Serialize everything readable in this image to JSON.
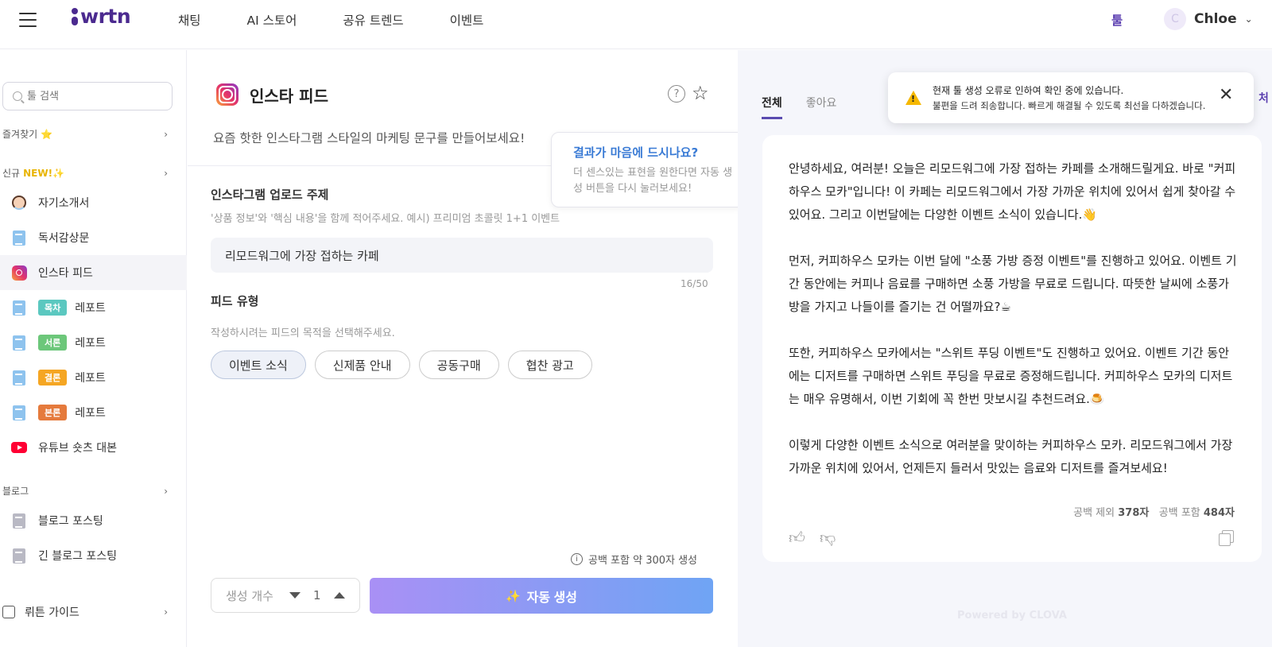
{
  "brand": "wrtn",
  "nav": {
    "links": [
      "채팅",
      "AI 스토어",
      "공유 트렌드",
      "이벤트"
    ],
    "tool_link": "툴",
    "user": {
      "avatar_initial": "C",
      "name": "Chloe"
    }
  },
  "sidebar": {
    "search_placeholder": "툴 검색",
    "favorites_label": "즐겨찾기",
    "favorites_emoji": "⭐",
    "new_label": "신규",
    "new_tag": "NEW!✨",
    "items": [
      {
        "label": "자기소개서",
        "icon": "person-icon"
      },
      {
        "label": "독서감상문",
        "icon": "document-icon"
      },
      {
        "label": "인스타 피드",
        "icon": "instagram-icon"
      },
      {
        "badge": "목차",
        "badge_color": "#5bc8c0",
        "label": "레포트",
        "icon": "document-icon"
      },
      {
        "badge": "서론",
        "badge_color": "#6cc77a",
        "label": "레포트",
        "icon": "document-icon"
      },
      {
        "badge": "결론",
        "badge_color": "#f5a623",
        "label": "레포트",
        "icon": "document-icon"
      },
      {
        "badge": "본론",
        "badge_color": "#e57a3c",
        "label": "레포트",
        "icon": "document-icon"
      },
      {
        "label": "유튜브 숏츠 대본",
        "icon": "youtube-icon"
      }
    ],
    "blog_label": "블로그",
    "blog_items": [
      {
        "label": "블로그 포스팅",
        "icon": "document-icon"
      },
      {
        "label": "긴 블로그 포스팅",
        "icon": "document-icon"
      }
    ],
    "guide_label": "뤼튼 가이드"
  },
  "main": {
    "title": "인스타 피드",
    "subtitle": "요즘 핫한 인스타그램 스타일의 마케팅 문구를 만들어보세요!",
    "topic_label": "인스타그램 업로드 주제",
    "topic_hint": "'상품 정보'와 '핵심 내용'을 함께 적어주세요. 예시) 프리미엄 초콜릿 1+1 이벤트",
    "topic_value": "리모드워그에 가장 접하는 카페",
    "topic_counter": "16/50",
    "feed_type_label": "피드 유형",
    "feed_type_hint": "작성하시려는 피드의 목적을 선택해주세요.",
    "feed_types": [
      "이벤트 소식",
      "신제품 안내",
      "공동구매",
      "협찬 광고"
    ],
    "selected_feed_type": "이벤트 소식",
    "gen_note": "공백 포함 약 300자 생성",
    "count_label": "생성 개수",
    "count_value": "1",
    "generate_button": "자동 생성"
  },
  "tooltip": {
    "title": "결과가 마음에 드시나요?",
    "body": "더 센스있는 표현을 원한다면 자동 생성 버튼을 다시 눌러보세요!"
  },
  "results": {
    "tabs": [
      "전체",
      "좋아요"
    ],
    "active_tab": "전체",
    "edge_text": "처",
    "text": "안녕하세요, 여러분! 오늘은 리모드워그에 가장 접하는 카페를 소개해드릴게요. 바로 \"커피하우스 모카\"입니다! 이 카페는 리모드워그에서 가장 가까운 위치에 있어서 쉽게 찾아갈 수 있어요. 그리고 이번달에는 다양한 이벤트 소식이 있습니다.👋\n\n먼저, 커피하우스 모카는 이번 달에 \"소풍 가방 증정 이벤트\"를 진행하고 있어요. 이벤트 기간 동안에는 커피나 음료를 구매하면 소풍 가방을 무료로 드립니다. 따뜻한 날씨에 소풍가방을 가지고 나들이를 즐기는 건 어떨까요?☕\n\n또한, 커피하우스 모카에서는 \"스위트 푸딩 이벤트\"도 진행하고 있어요. 이벤트 기간 동안에는 디저트를 구매하면 스위트 푸딩을 무료로 증정해드립니다. 커피하우스 모카의 디저트는 매우 유명해서, 이번 기회에 꼭 한번 맛보시길 추천드려요.🍮\n\n이렇게 다양한 이벤트 소식으로 여러분을 맞이하는 커피하우스 모카. 리모드워그에서 가장 가까운 위치에 있어서, 언제든지 들러서 맛있는 음료와 디저트를 즐겨보세요!",
    "char_excl_label": "공백 제외",
    "char_excl_value": "378자",
    "char_incl_label": "공백 포함",
    "char_incl_value": "484자",
    "powered_by": "Powered by CLOVA"
  },
  "toast": {
    "title": "현재 툴 생성 오류로 인하여 확인 중에 있습니다.",
    "body": "불편을 드려 죄송합니다. 빠르게 해결될 수 있도록 최선을 다하겠습니다."
  }
}
